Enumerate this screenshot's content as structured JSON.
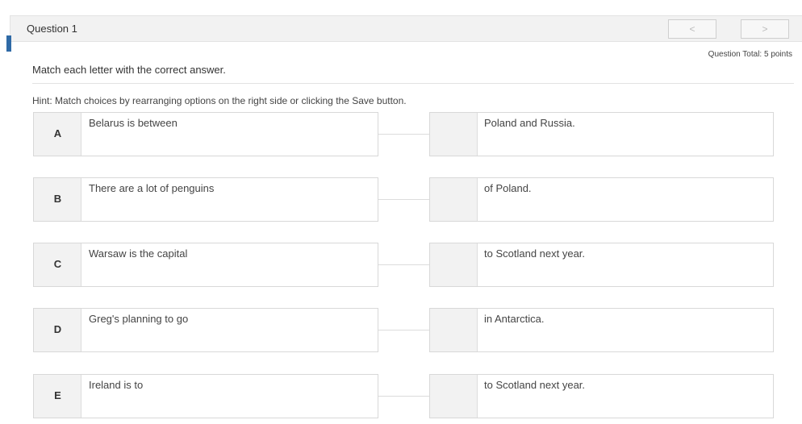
{
  "header": {
    "question_label": "Question 1",
    "prev_label": "<",
    "next_label": ">"
  },
  "question": {
    "total": "Question Total: 5 points",
    "instruction": "Match each letter with the correct answer.",
    "hint": "Hint: Match choices by rearranging options on the right side or clicking the Save button."
  },
  "pairs": [
    {
      "letter": "A",
      "left": "Belarus is between",
      "right": "Poland and Russia."
    },
    {
      "letter": "B",
      "left": "There are a lot of penguins",
      "right": "of Poland."
    },
    {
      "letter": "C",
      "left": "Warsaw is the capital",
      "right": "to Scotland next year."
    },
    {
      "letter": "D",
      "left": "Greg's planning to go",
      "right": "in Antarctica."
    },
    {
      "letter": "E",
      "left": "Ireland is to",
      "right": "to Scotland next year."
    }
  ]
}
